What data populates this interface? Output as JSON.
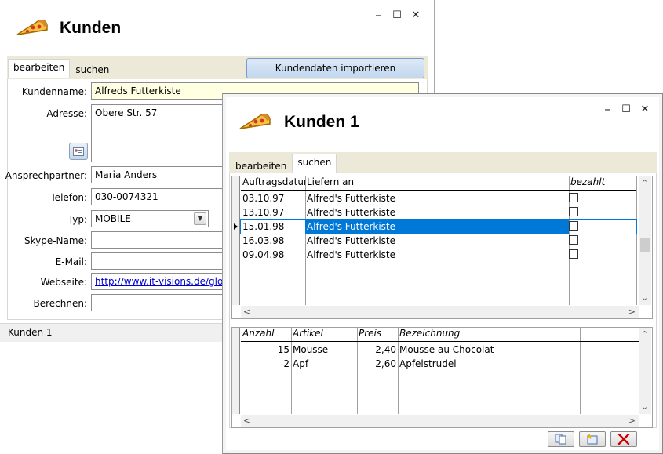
{
  "window1": {
    "title": "Kunden",
    "tabs": [
      {
        "label": "bearbeiten"
      },
      {
        "label": "suchen"
      }
    ],
    "import_button": "Kundendaten importieren",
    "fields": {
      "kundenname": {
        "label": "Kundenname:",
        "value": "Alfreds Futterkiste"
      },
      "adresse": {
        "label": "Adresse:",
        "value": "Obere Str. 57"
      },
      "ansprechpartner": {
        "label": "Ansprechpartner:",
        "value": "Maria Anders"
      },
      "telefon": {
        "label": "Telefon:",
        "value": "030-0074321"
      },
      "typ": {
        "label": "Typ:",
        "value": "MOBILE"
      },
      "skype": {
        "label": "Skype-Name:",
        "value": ""
      },
      "email": {
        "label": "E-Mail:",
        "value": ""
      },
      "webseite": {
        "label": "Webseite:",
        "value": "http://www.it-visions.de/glossar"
      },
      "berechnen": {
        "label": "Berechnen:",
        "value": ""
      }
    },
    "status": "Kunden 1"
  },
  "window2": {
    "title": "Kunden 1",
    "tabs": [
      {
        "label": "bearbeiten"
      },
      {
        "label": "suchen"
      }
    ],
    "orders_grid": {
      "columns": [
        "Auftragsdatum",
        "Liefern an",
        "bezahlt"
      ],
      "rows": [
        {
          "date": "03.10.97",
          "ship_to": "Alfred's Futterkiste",
          "paid": false
        },
        {
          "date": "13.10.97",
          "ship_to": "Alfred's Futterkiste",
          "paid": false
        },
        {
          "date": "15.01.98",
          "ship_to": "Alfred's Futterkiste",
          "paid": false
        },
        {
          "date": "16.03.98",
          "ship_to": "Alfred's Futterkiste",
          "paid": false
        },
        {
          "date": "09.04.98",
          "ship_to": "Alfred's Futterkiste",
          "paid": false
        }
      ],
      "selected_row": 2
    },
    "items_grid": {
      "columns": [
        "Anzahl",
        "Artikel",
        "Preis",
        "Bezeichnung"
      ],
      "rows": [
        {
          "qty": "15",
          "article": "Mousse",
          "price": "2,40",
          "desc": "Mousse au Chocolat"
        },
        {
          "qty": "2",
          "article": "Apf",
          "price": "2,60",
          "desc": "Apfelstrudel"
        }
      ]
    },
    "bottom_buttons": [
      {
        "icon": "copy-icon"
      },
      {
        "icon": "new-record-icon"
      },
      {
        "icon": "delete-icon"
      }
    ]
  },
  "colors": {
    "selection": "#0078d7",
    "tab_bar": "#ece9d8",
    "yellow_field": "#ffffe1",
    "delete_red": "#cc0000"
  }
}
